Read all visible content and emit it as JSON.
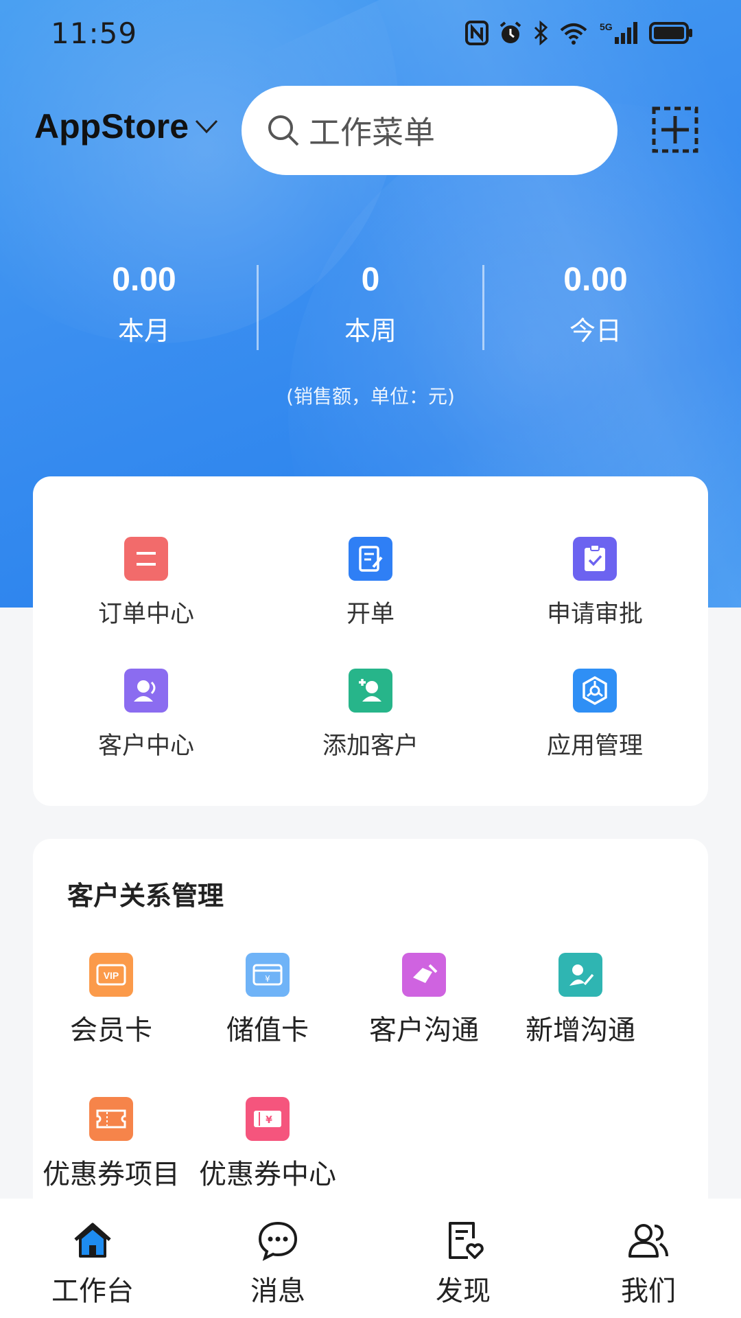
{
  "status_bar": {
    "time": "11:59"
  },
  "topbar": {
    "store": "AppStore",
    "search_placeholder": "工作菜单"
  },
  "stats": [
    {
      "value": "0.00",
      "label": "本月"
    },
    {
      "value": "0",
      "label": "本周"
    },
    {
      "value": "0.00",
      "label": "今日"
    }
  ],
  "stats_note": "(销售额，单位：元)",
  "quick_menu": [
    {
      "label": "订单中心",
      "icon": "order-icon",
      "color": "#f26b6b"
    },
    {
      "label": "开单",
      "icon": "create-order-icon",
      "color": "#2f7ff5"
    },
    {
      "label": "申请审批",
      "icon": "approval-icon",
      "color": "#6c63f0"
    },
    {
      "label": "客户中心",
      "icon": "customer-icon",
      "color": "#8b6cf0"
    },
    {
      "label": "添加客户",
      "icon": "add-customer-icon",
      "color": "#27b58a"
    },
    {
      "label": "应用管理",
      "icon": "app-manage-icon",
      "color": "#2f8ff5"
    }
  ],
  "crm": {
    "title": "客户关系管理",
    "items": [
      {
        "label": "会员卡",
        "icon": "vip-card-icon",
        "color": "#fb9a4a"
      },
      {
        "label": "储值卡",
        "icon": "stored-value-card-icon",
        "color": "#6fb3f7"
      },
      {
        "label": "客户沟通",
        "icon": "customer-communication-icon",
        "color": "#cf63e0"
      },
      {
        "label": "新增沟通",
        "icon": "new-communication-icon",
        "color": "#2fb5b2"
      },
      {
        "label": "优惠券项目",
        "icon": "coupon-item-icon",
        "color": "#f6844a"
      },
      {
        "label": "优惠券中心",
        "icon": "coupon-center-icon",
        "color": "#f5557d"
      }
    ]
  },
  "bottom_nav": [
    {
      "label": "工作台",
      "icon": "home-icon",
      "active": true
    },
    {
      "label": "消息",
      "icon": "message-icon"
    },
    {
      "label": "发现",
      "icon": "discover-icon"
    },
    {
      "label": "我们",
      "icon": "people-icon"
    }
  ],
  "colors": {
    "accent": "#2f86ee",
    "active_tab": "#1e8cf0"
  }
}
